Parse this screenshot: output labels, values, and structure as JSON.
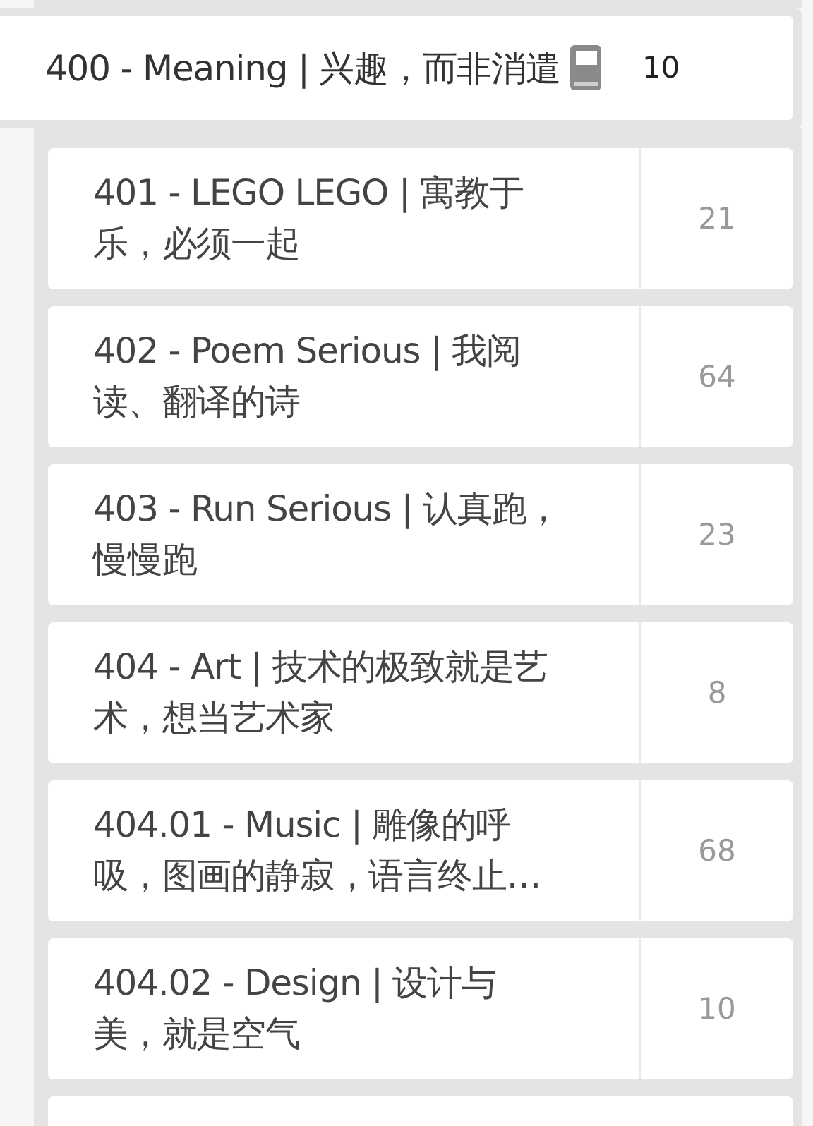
{
  "parent": {
    "title": "400 - Meaning | 兴趣，而非消遣",
    "count": "10"
  },
  "items": [
    {
      "title_lines": [
        "401 - LEGO LEGO | 寓教于",
        "乐，必须一起"
      ],
      "count": "21"
    },
    {
      "title_lines": [
        "402 - Poem Serious | 我阅",
        "读、翻译的诗"
      ],
      "count": "64"
    },
    {
      "title_lines": [
        "403 - Run Serious | 认真跑，",
        "慢慢跑"
      ],
      "count": "23"
    },
    {
      "title_lines": [
        "404 - Art | 技术的极致就是艺",
        "术，想当艺术家"
      ],
      "count": "8"
    },
    {
      "title_lines": [
        "404.01 - Music | 雕像的呼",
        "吸，图画的静寂，语言终止…"
      ],
      "count": "68"
    },
    {
      "title_lines": [
        "404.02 - Design | 设计与",
        "美，就是空气"
      ],
      "count": "10"
    }
  ]
}
